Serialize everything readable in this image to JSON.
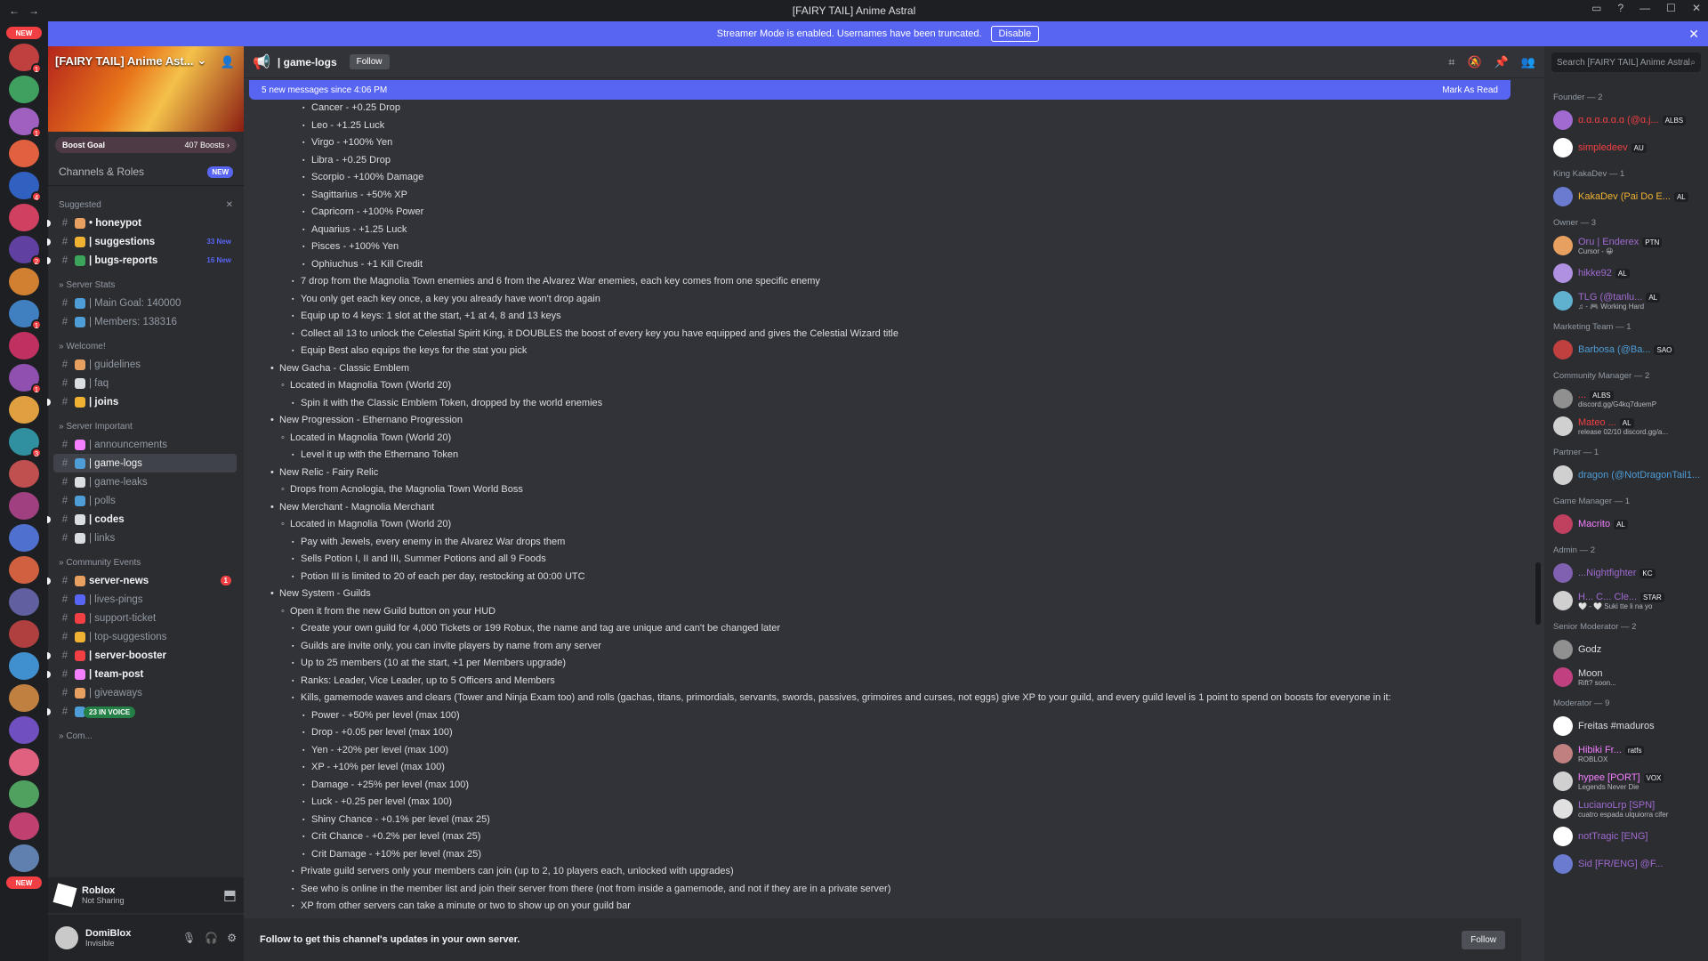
{
  "window": {
    "title": "[FAIRY TAIL] Anime Astral"
  },
  "banner": {
    "text": "Streamer Mode is enabled. Usernames have been truncated.",
    "disable_label": "Disable"
  },
  "rail": {
    "new_top": "NEW",
    "new_bottom": "NEW",
    "badges": [
      "1",
      "1",
      "1",
      "1",
      "4",
      "1",
      "2",
      "1",
      "1",
      "2",
      "1",
      "1",
      "3",
      "76"
    ]
  },
  "server": {
    "name": "[FAIRY TAIL] Anime Ast...",
    "boost_goal": "Boost Goal",
    "boosts": "407 Boosts ›",
    "channels_roles": "Channels & Roles",
    "new_tag": "NEW"
  },
  "categories": {
    "suggested": "Suggested",
    "server_stats": "» Server Stats",
    "welcome": "» Welcome!",
    "server_important": "» Server Important",
    "community_events": "» Community Events",
    "community": "» Com..."
  },
  "channels": {
    "suggested": [
      {
        "name": "• honeypot",
        "color": "#e8a060"
      },
      {
        "name": "| suggestions",
        "count": "33 New",
        "color": "#f0b232"
      },
      {
        "name": "| bugs-reports",
        "count": "16 New",
        "color": "#3ba55c"
      }
    ],
    "stats": [
      {
        "name": "| Main Goal: 140000",
        "color": "#4f9dd6"
      },
      {
        "name": "| Members: 138316",
        "color": "#4f9dd6"
      }
    ],
    "welcome": [
      {
        "name": "| guidelines",
        "color": "#e8a060"
      },
      {
        "name": "| faq",
        "color": "#dbdee1"
      },
      {
        "name": "| joins",
        "color": "#f0b232"
      }
    ],
    "important": [
      {
        "name": "| announcements",
        "color": "#f47fff"
      },
      {
        "name": "| game-logs",
        "color": "#4f9dd6"
      },
      {
        "name": "| game-leaks",
        "color": "#dbdee1"
      },
      {
        "name": "| polls",
        "color": "#4f9dd6"
      },
      {
        "name": "| codes",
        "color": "#dbdee1"
      },
      {
        "name": "| links",
        "color": "#dbdee1"
      }
    ],
    "events": [
      {
        "name": "server-news",
        "mention": "1",
        "color": "#e8a060"
      },
      {
        "name": "| lives-pings",
        "color": "#5865f2"
      },
      {
        "name": "| support-ticket",
        "color": "#f23f43"
      },
      {
        "name": "| top-suggestions",
        "color": "#f0b232"
      },
      {
        "name": "| server-booster",
        "color": "#f23f43"
      },
      {
        "name": "| team-post",
        "color": "#f47fff"
      },
      {
        "name": "| giveaways",
        "color": "#e8a060"
      },
      {
        "name": "| level-up",
        "color": "#4f9dd6"
      }
    ],
    "voice_label": "23 IN VOICE"
  },
  "activity": {
    "title": "Roblox",
    "status": "Not Sharing"
  },
  "user": {
    "name": "DomiBlox",
    "status": "Invisible"
  },
  "header": {
    "channel": "| game-logs",
    "follow": "Follow"
  },
  "newbar": {
    "text": "5 new messages since 4:06 PM",
    "mark": "Mark As Read"
  },
  "messages": [
    {
      "lvl": 4,
      "text": "Cancer - +0.25 Drop"
    },
    {
      "lvl": 4,
      "text": "Leo - +1.25 Luck"
    },
    {
      "lvl": 4,
      "text": "Virgo - +100% Yen"
    },
    {
      "lvl": 4,
      "text": "Libra - +0.25 Drop"
    },
    {
      "lvl": 4,
      "text": "Scorpio - +100% Damage"
    },
    {
      "lvl": 4,
      "text": "Sagittarius - +50% XP"
    },
    {
      "lvl": 4,
      "text": "Capricorn - +100% Power"
    },
    {
      "lvl": 4,
      "text": "Aquarius - +1.25 Luck"
    },
    {
      "lvl": 4,
      "text": "Pisces - +100% Yen"
    },
    {
      "lvl": 4,
      "text": "Ophiuchus - +1 Kill Credit"
    },
    {
      "lvl": 3,
      "text": "7 drop from the Magnolia Town enemies and 6 from the Alvarez War enemies, each key comes from one specific enemy"
    },
    {
      "lvl": 3,
      "text": "You only get each key once, a key you already have won't drop again"
    },
    {
      "lvl": 3,
      "text": "Equip up to 4 keys: 1 slot at the start, +1 at 4, 8 and 13 keys"
    },
    {
      "lvl": 3,
      "text": "Collect all 13 to unlock the Celestial Spirit King, it DOUBLES the boost of every key you have equipped and gives the Celestial Wizard title"
    },
    {
      "lvl": 3,
      "text": "Equip Best also equips the keys for the stat you pick"
    },
    {
      "lvl": 1,
      "text": "New Gacha - Classic Emblem"
    },
    {
      "lvl": 2,
      "text": "Located in Magnolia Town (World 20)"
    },
    {
      "lvl": 3,
      "text": "Spin it with the Classic Emblem Token, dropped by the world enemies"
    },
    {
      "lvl": 1,
      "text": "New Progression - Ethernano Progression"
    },
    {
      "lvl": 2,
      "text": "Located in Magnolia Town (World 20)"
    },
    {
      "lvl": 3,
      "text": "Level it up with the Ethernano Token"
    },
    {
      "lvl": 1,
      "text": "New Relic - Fairy Relic"
    },
    {
      "lvl": 2,
      "text": "Drops from Acnologia, the Magnolia Town World Boss"
    },
    {
      "lvl": 1,
      "text": "New Merchant - Magnolia Merchant"
    },
    {
      "lvl": 2,
      "text": "Located in Magnolia Town (World 20)"
    },
    {
      "lvl": 3,
      "text": "Pay with Jewels, every enemy in the Alvarez War drops them"
    },
    {
      "lvl": 3,
      "text": "Sells Potion I, II and III, Summer Potions and all 9 Foods"
    },
    {
      "lvl": 3,
      "text": "Potion III is limited to 20 of each per day, restocking at 00:00 UTC"
    },
    {
      "lvl": 1,
      "text": "New System - Guilds"
    },
    {
      "lvl": 2,
      "text": "Open it from the new Guild button on your HUD"
    },
    {
      "lvl": 3,
      "text": "Create your own guild for 4,000 Tickets or 199 Robux, the name and tag are unique and can't be changed later"
    },
    {
      "lvl": 3,
      "text": "Guilds are invite only, you can invite players by name from any server"
    },
    {
      "lvl": 3,
      "text": "Up to 25 members (10 at the start, +1 per Members upgrade)"
    },
    {
      "lvl": 3,
      "text": "Ranks: Leader, Vice Leader, up to 5 Officers and Members"
    },
    {
      "lvl": 3,
      "text": "Kills, gamemode waves and clears (Tower and Ninja Exam too) and rolls (gachas, titans, primordials, servants, swords, passives, grimoires and curses, not eggs) give XP to your guild, and every guild level is 1 point to spend on boosts for everyone in it:"
    },
    {
      "lvl": 4,
      "text": "Power - +50% per level (max 100)"
    },
    {
      "lvl": 4,
      "text": "Drop - +0.05 per level (max 100)"
    },
    {
      "lvl": 4,
      "text": "Yen - +20% per level (max 100)"
    },
    {
      "lvl": 4,
      "text": "XP - +10% per level (max 100)"
    },
    {
      "lvl": 4,
      "text": "Damage - +25% per level (max 100)"
    },
    {
      "lvl": 4,
      "text": "Luck - +0.25 per level (max 100)"
    },
    {
      "lvl": 4,
      "text": "Shiny Chance - +0.1% per level (max 25)"
    },
    {
      "lvl": 4,
      "text": "Crit Chance - +0.2% per level (max 25)"
    },
    {
      "lvl": 4,
      "text": "Crit Damage - +10% per level (max 25)"
    },
    {
      "lvl": 3,
      "text": "Private guild servers only your members can join (up to 2, 10 players each, unlocked with upgrades)"
    },
    {
      "lvl": 3,
      "text": "See who is online in the member list and join their server from there (not from inside a gamemode, and not if they are in a private server)"
    },
    {
      "lvl": 3,
      "text": "XP from other servers can take a minute or two to show up on your guild bar"
    }
  ],
  "footer": {
    "text": "Follow to get this channel's updates in your own server.",
    "button": "Follow"
  },
  "search": {
    "placeholder": "Search [FAIRY TAIL] Anime Astral"
  },
  "members": [
    {
      "group": "Founder — 2",
      "items": [
        {
          "name": "ɑ.ɑ.ɑ.ɑ.ɑ.ɑ (@ɑ.j...",
          "tag": "ALBS",
          "color": "#f23f43",
          "av": "#a06ad0"
        },
        {
          "name": "simpledeev",
          "tag": "AU",
          "color": "#f23f43",
          "av": "#ffffff"
        }
      ]
    },
    {
      "group": "King KakaDev — 1",
      "items": [
        {
          "name": "KakaDev (Pai Do E...",
          "tag": "AL",
          "color": "#f0b232",
          "av": "#6a7bd0"
        }
      ]
    },
    {
      "group": "Owner — 3",
      "items": [
        {
          "name": "Oru | Enderex",
          "sub": "Cursor - 😀",
          "tag": "PTN",
          "color": "#a06ad0",
          "av": "#e8a060"
        },
        {
          "name": "hikke92",
          "tag": "AL",
          "color": "#a06ad0",
          "av": "#b090e0"
        },
        {
          "name": "TLG (@tanlu...",
          "sub": "♫ - 🎮 Working Hard",
          "tag": "AL",
          "color": "#a06ad0",
          "av": "#60b0d0"
        }
      ]
    },
    {
      "group": "Marketing Team — 1",
      "items": [
        {
          "name": "Barbosa (@Ba...",
          "tag": "SAO",
          "color": "#4f9dd6",
          "av": "#c04040"
        }
      ]
    },
    {
      "group": "Community Manager — 2",
      "items": [
        {
          "name": "...",
          "sub": "discord.gg/G4kq7duemP",
          "tag": "ALBS",
          "color": "#f23f43",
          "av": "#909090"
        },
        {
          "name": "Mateo ...",
          "sub": "release 02/10 discord.gg/a...",
          "tag": "AL",
          "color": "#f23f43",
          "av": "#d0d0d0"
        }
      ]
    },
    {
      "group": "Partner — 1",
      "items": [
        {
          "name": "dragon (@NotDragonTail1...",
          "color": "#4f9dd6",
          "av": "#d0d0d0"
        }
      ]
    },
    {
      "group": "Game Manager — 1",
      "items": [
        {
          "name": "Macrito",
          "tag": "AL",
          "color": "#f47fff",
          "av": "#c04060"
        }
      ]
    },
    {
      "group": "Admin — 2",
      "items": [
        {
          "name": "...Nightfighter",
          "tag": "KC",
          "color": "#a06ad0",
          "av": "#8060b0"
        },
        {
          "name": "H... C... Cle...",
          "sub": "🤍 - 🤍 Suki tte li na yo",
          "tag": "STAR",
          "color": "#a06ad0",
          "av": "#d0d0d0"
        }
      ]
    },
    {
      "group": "Senior Moderator — 2",
      "items": [
        {
          "name": "Godz",
          "color": "#dbdee1",
          "av": "#909090"
        },
        {
          "name": "Moon",
          "sub": "Rift? soon...",
          "color": "#dbdee1",
          "av": "#c04080"
        }
      ]
    },
    {
      "group": "Moderator — 9",
      "items": [
        {
          "name": "Freitas #maduros",
          "color": "#dbdee1",
          "av": "#ffffff"
        },
        {
          "name": "Hibiki Fr...",
          "sub": "ROBLOX",
          "tag": "ratfs",
          "color": "#f47fff",
          "av": "#c08080"
        },
        {
          "name": "hypee [PORT]",
          "sub": "Legends Never Die",
          "tag": "VOX",
          "color": "#f47fff",
          "av": "#d0d0d0"
        },
        {
          "name": "LucianoLrp [SPN]",
          "sub": "cuatro espada ulquiorra cifer",
          "color": "#a06ad0",
          "av": "#e0e0e0"
        },
        {
          "name": "notTragic [ENG]",
          "color": "#a06ad0",
          "av": "#ffffff"
        },
        {
          "name": "Sid [FR/ENG] @F...",
          "color": "#a06ad0",
          "av": "#6a7bd0"
        }
      ]
    }
  ]
}
